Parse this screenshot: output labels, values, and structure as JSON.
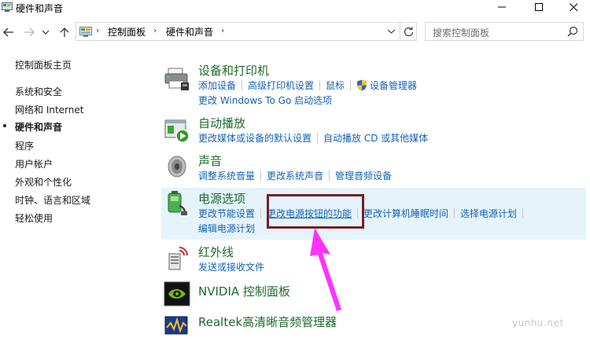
{
  "window": {
    "title": "硬件和声音"
  },
  "navigation": {
    "breadcrumbs": [
      "控制面板",
      "硬件和声音"
    ],
    "search_placeholder": "搜索控制面板"
  },
  "sidebar": {
    "items": [
      {
        "label": "控制面板主页",
        "current": false
      },
      {
        "label": "系统和安全",
        "current": false
      },
      {
        "label": "网络和 Internet",
        "current": false
      },
      {
        "label": "硬件和声音",
        "current": true
      },
      {
        "label": "程序",
        "current": false
      },
      {
        "label": "用户帐户",
        "current": false
      },
      {
        "label": "外观和个性化",
        "current": false
      },
      {
        "label": "时钟、语言和区域",
        "current": false
      },
      {
        "label": "轻松使用",
        "current": false
      }
    ]
  },
  "categories": [
    {
      "title": "设备和打印机",
      "icon": "printer-icon",
      "links_row1": [
        "添加设备",
        "高级打印机设置",
        "鼠标",
        "设备管理器"
      ],
      "links_row2": [
        "更改 Windows To Go 启动选项"
      ]
    },
    {
      "title": "自动播放",
      "icon": "autoplay-icon",
      "links_row1": [
        "更改媒体或设备的默认设置",
        "自动播放 CD 或其他媒体"
      ]
    },
    {
      "title": "声音",
      "icon": "speaker-icon",
      "links_row1": [
        "调整系统音量",
        "更改系统声音",
        "管理音频设备"
      ]
    },
    {
      "title": "电源选项",
      "icon": "power-options-icon",
      "links_row1": [
        "更改节能设置",
        "更改电源按钮的功能",
        "更改计算机睡眠时间",
        "选择电源计划"
      ],
      "links_row2": [
        "编辑电源计划"
      ]
    },
    {
      "title": "红外线",
      "icon": "infrared-icon",
      "links_row1": [
        "发送或接收文件"
      ]
    },
    {
      "title": "NVIDIA 控制面板",
      "icon": "nvidia-icon"
    },
    {
      "title": "Realtek高清晰音频管理器",
      "icon": "realtek-audio-icon"
    }
  ],
  "watermark": "yunhu.net",
  "colors": {
    "link": "#1463b7",
    "category_title": "#1e6b2d",
    "highlight": "#e5f3fb",
    "callout_box": "#7a1f24",
    "arrow": "#ff33ff"
  }
}
